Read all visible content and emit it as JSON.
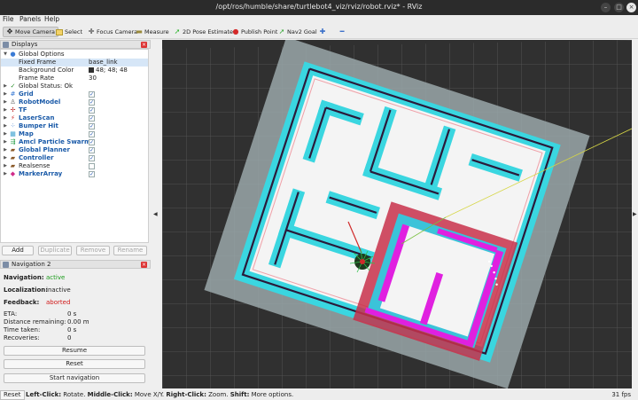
{
  "window": {
    "title": "/opt/ros/humble/share/turtlebot4_viz/rviz/robot.rviz* - RViz"
  },
  "menu": [
    "File",
    "Panels",
    "Help"
  ],
  "toolbar": {
    "tools": [
      {
        "label": "Move Camera",
        "icon": "camera-move-icon"
      },
      {
        "label": "Select",
        "icon": "select-icon"
      },
      {
        "label": "Focus Camera",
        "icon": "focus-icon"
      },
      {
        "label": "Measure",
        "icon": "ruler-icon"
      },
      {
        "label": "2D Pose Estimate",
        "icon": "pose-arrow-icon"
      },
      {
        "label": "Publish Point",
        "icon": "map-pin-icon"
      },
      {
        "label": "Nav2 Goal",
        "icon": "goal-arrow-icon"
      }
    ]
  },
  "displays": {
    "title": "Displays",
    "rows": [
      {
        "name": "Global Options",
        "value": ""
      },
      {
        "name": "Fixed Frame",
        "value": "base_link"
      },
      {
        "name": "Background Color",
        "value": "48; 48; 48"
      },
      {
        "name": "Frame Rate",
        "value": "30"
      },
      {
        "name": "Global Status: Ok",
        "value": ""
      },
      {
        "name": "Grid",
        "checked": "✓"
      },
      {
        "name": "RobotModel",
        "checked": "✓"
      },
      {
        "name": "TF",
        "checked": "✓"
      },
      {
        "name": "LaserScan",
        "checked": "✓"
      },
      {
        "name": "Bumper Hit",
        "checked": "✓"
      },
      {
        "name": "Map",
        "checked": "✓"
      },
      {
        "name": "Amcl Particle Swarm",
        "checked": "✓"
      },
      {
        "name": "Global Planner",
        "checked": "✓"
      },
      {
        "name": "Controller",
        "checked": "✓"
      },
      {
        "name": "Realsense",
        "checked": ""
      },
      {
        "name": "MarkerArray",
        "checked": "✓"
      }
    ],
    "buttons": {
      "add": "Add",
      "duplicate": "Duplicate",
      "remove": "Remove",
      "rename": "Rename"
    }
  },
  "navigation": {
    "title": "Navigation 2",
    "navigation_label": "Navigation:",
    "navigation_value": "active",
    "localization_label": "Localization:",
    "localization_value": "inactive",
    "feedback_label": "Feedback:",
    "feedback_value": "aborted",
    "eta_label": "ETA:",
    "eta_value": "0 s",
    "distance_label": "Distance remaining:",
    "distance_value": "0.00 m",
    "time_label": "Time taken:",
    "time_value": "0 s",
    "recoveries_label": "Recoveries:",
    "recoveries_value": "0",
    "resume": "Resume",
    "reset": "Reset",
    "start": "Start navigation"
  },
  "statusbar": {
    "reset": "Reset",
    "hint_left_click": "Left-Click:",
    "hint_left_action": " Rotate. ",
    "hint_middle_click": "Middle-Click:",
    "hint_middle_action": " Move X/Y. ",
    "hint_right_click": "Right-Click:",
    "hint_right_action": " Zoom. ",
    "hint_shift": "Shift:",
    "hint_shift_action": " More options.",
    "fps": "31 fps"
  },
  "colors": {
    "background": "#303030",
    "costmap_cyan": "#33e0e6",
    "costmap_magenta": "#e020e0",
    "costmap_red": "#c8304a",
    "map_unknown": "#9aa7a9",
    "active_green": "#1b9b1b",
    "error_red": "#d01818"
  }
}
